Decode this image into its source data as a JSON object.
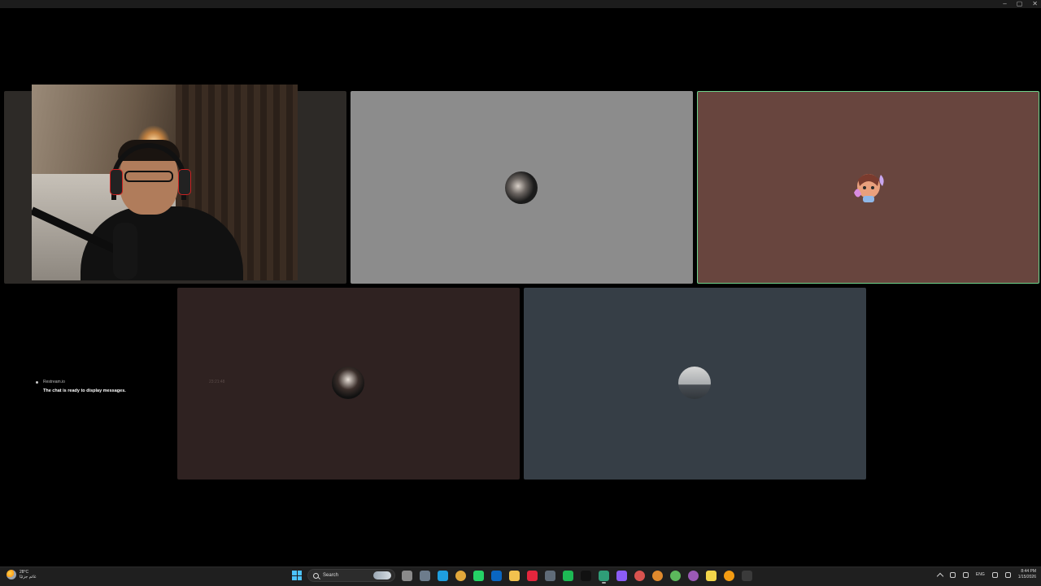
{
  "window": {
    "controls": [
      "–",
      "▢",
      "✕"
    ]
  },
  "tiles": [
    {
      "name": "camera-tile"
    },
    {
      "name": "participant-2",
      "avatar_color": "#8c8c8c"
    },
    {
      "name": "participant-3-speaking",
      "avatar_color": "#68453e",
      "highlight": "#6fd38c"
    },
    {
      "name": "participant-4",
      "timestamp": "23:21:48"
    },
    {
      "name": "participant-5",
      "avatar_color": "#363e46"
    }
  ],
  "chat": {
    "source": "Restream.io",
    "message": "The chat is ready to display messages."
  },
  "taskbar": {
    "weather": {
      "temp": "28°C",
      "desc": "غائم جزئيًا"
    },
    "search_placeholder": "Search",
    "apps": [
      {
        "icon": "file-explorer-icon",
        "color": "#8a8a8a"
      },
      {
        "icon": "app-icon",
        "color": "#6d7c8c"
      },
      {
        "icon": "edge-icon",
        "color": "#1f9ede"
      },
      {
        "icon": "chrome-icon",
        "color": "#e2a83b"
      },
      {
        "icon": "whatsapp-icon",
        "color": "#25d366"
      },
      {
        "icon": "linkedin-icon",
        "color": "#0a66c2"
      },
      {
        "icon": "folder-icon",
        "color": "#f2c14e"
      },
      {
        "icon": "opera-icon",
        "color": "#e3263d"
      },
      {
        "icon": "app-icon",
        "color": "#5f6b78"
      },
      {
        "icon": "spotify-icon",
        "color": "#1db954"
      },
      {
        "icon": "tiktok-icon",
        "color": "#111111"
      },
      {
        "icon": "streamyard-icon",
        "color": "#2f9d78"
      },
      {
        "icon": "messenger-icon",
        "color": "#8b5cf6"
      },
      {
        "icon": "chrome-icon",
        "color": "#d9534f"
      },
      {
        "icon": "chrome-icon",
        "color": "#e08a2d"
      },
      {
        "icon": "chrome-icon",
        "color": "#5cb85c"
      },
      {
        "icon": "chrome-icon",
        "color": "#9b59b6"
      },
      {
        "icon": "sticky-notes-icon",
        "color": "#f1d54a"
      },
      {
        "icon": "chrome-icon",
        "color": "#f39c12"
      },
      {
        "icon": "app-icon",
        "color": "#3a3a3a"
      }
    ],
    "lang": "ENG",
    "time": "8:44 PM",
    "date": "1/15/2026"
  }
}
